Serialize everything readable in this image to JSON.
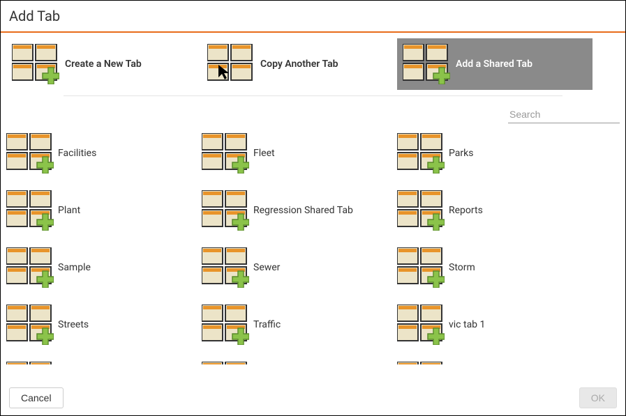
{
  "dialog": {
    "title": "Add Tab"
  },
  "modes": [
    {
      "id": "create-new-tab",
      "label": "Create a New Tab",
      "icon": "grid-plus",
      "selected": false
    },
    {
      "id": "copy-another-tab",
      "label": "Copy Another Tab",
      "icon": "grid-cursor",
      "selected": false
    },
    {
      "id": "add-shared-tab",
      "label": "Add a Shared Tab",
      "icon": "grid-plus",
      "selected": true
    }
  ],
  "search": {
    "placeholder": "Search",
    "value": ""
  },
  "tabs": [
    {
      "label": "Facilities"
    },
    {
      "label": "Fleet"
    },
    {
      "label": "Parks"
    },
    {
      "label": "Plant"
    },
    {
      "label": "Regression Shared Tab"
    },
    {
      "label": "Reports"
    },
    {
      "label": "Sample"
    },
    {
      "label": "Sewer"
    },
    {
      "label": "Storm"
    },
    {
      "label": "Streets"
    },
    {
      "label": "Traffic"
    },
    {
      "label": "vic tab 1"
    },
    {
      "label": ""
    },
    {
      "label": ""
    },
    {
      "label": ""
    }
  ],
  "footer": {
    "cancel": "Cancel",
    "ok": "OK"
  },
  "colors": {
    "accent": "#e86c1a",
    "selected_bg": "#8a8a8a"
  }
}
